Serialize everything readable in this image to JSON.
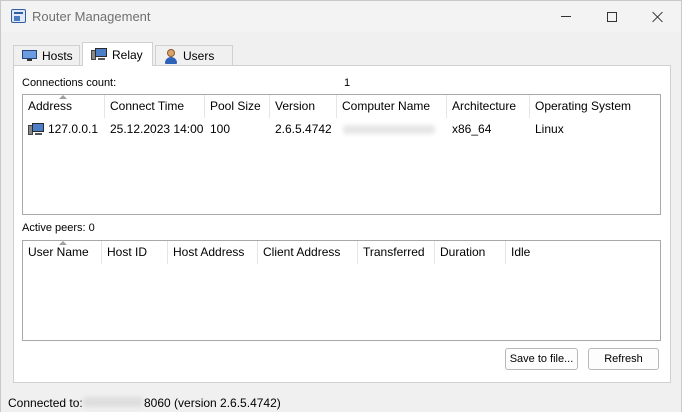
{
  "window": {
    "title": "Router Management"
  },
  "tabs": [
    {
      "label": "Hosts",
      "icon": "monitor-icon",
      "active": false
    },
    {
      "label": "Relay",
      "icon": "computer-icon",
      "active": true
    },
    {
      "label": "Users",
      "icon": "user-icon",
      "active": false
    }
  ],
  "connections": {
    "count_label": "Connections count:",
    "count_value": "1",
    "columns": [
      "Address",
      "Connect Time",
      "Pool Size",
      "Version",
      "Computer Name",
      "Architecture",
      "Operating System"
    ],
    "rows": [
      {
        "address": "127.0.0.1",
        "connect_time": "25.12.2023 14:00",
        "pool_size": "100",
        "version": "2.6.5.4742",
        "architecture": "x86_64",
        "operating_system": "Linux"
      }
    ]
  },
  "peers": {
    "label": "Active peers: 0",
    "columns": [
      "User Name",
      "Host ID",
      "Host Address",
      "Client Address",
      "Transferred",
      "Duration",
      "Idle"
    ]
  },
  "buttons": {
    "save": "Save to file...",
    "refresh": "Refresh"
  },
  "status": {
    "label": "Connected to:",
    "rest": "8060 (version 2.6.5.4742)"
  }
}
